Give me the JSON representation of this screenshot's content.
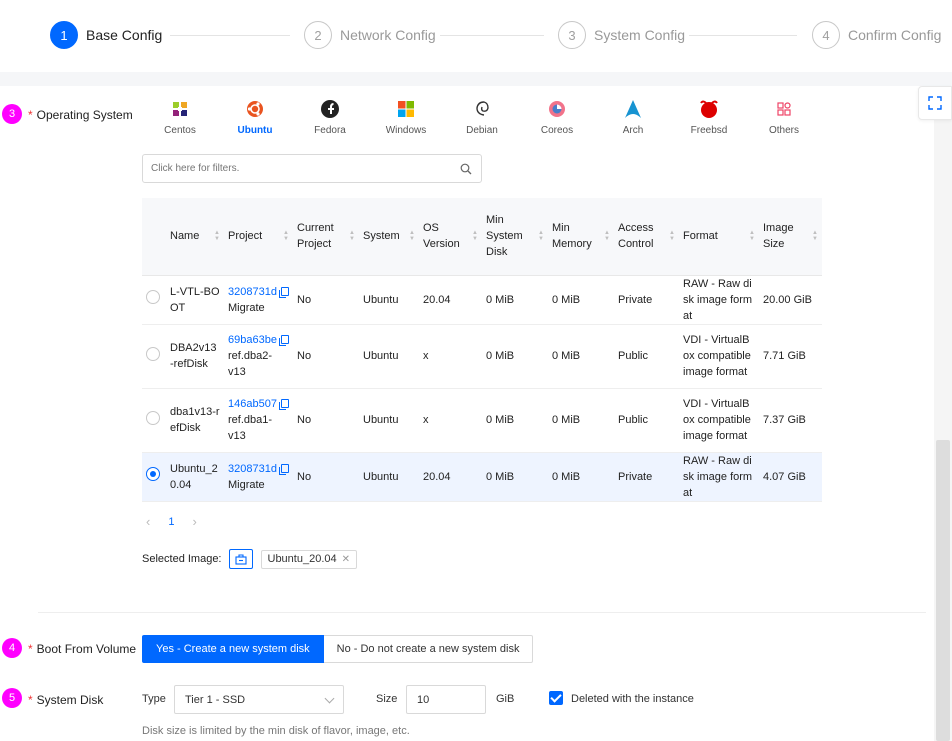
{
  "steps": [
    {
      "num": "1",
      "label": "Base Config"
    },
    {
      "num": "2",
      "label": "Network Config"
    },
    {
      "num": "3",
      "label": "System Config"
    },
    {
      "num": "4",
      "label": "Confirm Config"
    }
  ],
  "os_section": {
    "badge": "3",
    "label": "Operating System",
    "os_list": [
      {
        "name": "Centos",
        "icon": "centos-icon"
      },
      {
        "name": "Ubuntu",
        "icon": "ubuntu-icon",
        "selected": true
      },
      {
        "name": "Fedora",
        "icon": "fedora-icon"
      },
      {
        "name": "Windows",
        "icon": "windows-icon"
      },
      {
        "name": "Debian",
        "icon": "debian-icon"
      },
      {
        "name": "Coreos",
        "icon": "coreos-icon"
      },
      {
        "name": "Arch",
        "icon": "arch-icon"
      },
      {
        "name": "Freebsd",
        "icon": "freebsd-icon"
      },
      {
        "name": "Others",
        "icon": "others-icon"
      }
    ],
    "filter_placeholder": "Click here for filters."
  },
  "table": {
    "headers": [
      "Name",
      "Project",
      "Current Project",
      "System",
      "OS Version",
      "Min System Disk",
      "Min Memory",
      "Access Control",
      "Format",
      "Image Size"
    ],
    "rows": [
      {
        "name": "L-VTL-BOOT",
        "project_id": "3208731d",
        "project_name": "Migrate",
        "current": "No",
        "system": "Ubuntu",
        "os_version": "20.04",
        "min_disk": "0 MiB",
        "min_mem": "0 MiB",
        "access": "Private",
        "format": "RAW - Raw disk image format",
        "size": "20.00 GiB",
        "selected": false
      },
      {
        "name": "DBA2v13-refDisk",
        "project_id": "69ba63be",
        "project_name": "ref.dba2-v13",
        "current": "No",
        "system": "Ubuntu",
        "os_version": "x",
        "min_disk": "0 MiB",
        "min_mem": "0 MiB",
        "access": "Public",
        "format": "VDI - VirtualBox compatible image format",
        "size": "7.71 GiB",
        "selected": false
      },
      {
        "name": "dba1v13-refDisk",
        "project_id": "146ab507",
        "project_name": "ref.dba1-v13",
        "current": "No",
        "system": "Ubuntu",
        "os_version": "x",
        "min_disk": "0 MiB",
        "min_mem": "0 MiB",
        "access": "Public",
        "format": "VDI - VirtualBox compatible image format",
        "size": "7.37 GiB",
        "selected": false
      },
      {
        "name": "Ubuntu_20.04",
        "project_id": "3208731d",
        "project_name": "Migrate",
        "current": "No",
        "system": "Ubuntu",
        "os_version": "20.04",
        "min_disk": "0 MiB",
        "min_mem": "0 MiB",
        "access": "Private",
        "format": "RAW - Raw disk image format",
        "size": "4.07 GiB",
        "selected": true
      }
    ]
  },
  "pagination": {
    "current": "1"
  },
  "selected_image": {
    "label": "Selected Image:",
    "value": "Ubuntu_20.04"
  },
  "boot_volume": {
    "badge": "4",
    "label": "Boot From Volume",
    "yes_label": "Yes - Create a new system disk",
    "no_label": "No - Do not create a new system disk"
  },
  "system_disk": {
    "badge": "5",
    "label": "System Disk",
    "type_label": "Type",
    "type_value": "Tier 1 - SSD",
    "size_label": "Size",
    "size_value": "10",
    "unit": "GiB",
    "delete_label": "Deleted with the instance",
    "delete_checked": true,
    "hint": "Disk size is limited by the min disk of flavor, image, etc."
  },
  "colors": {
    "accent": "#0068ff",
    "badge": "#ff00ff",
    "required": "#e33333"
  }
}
